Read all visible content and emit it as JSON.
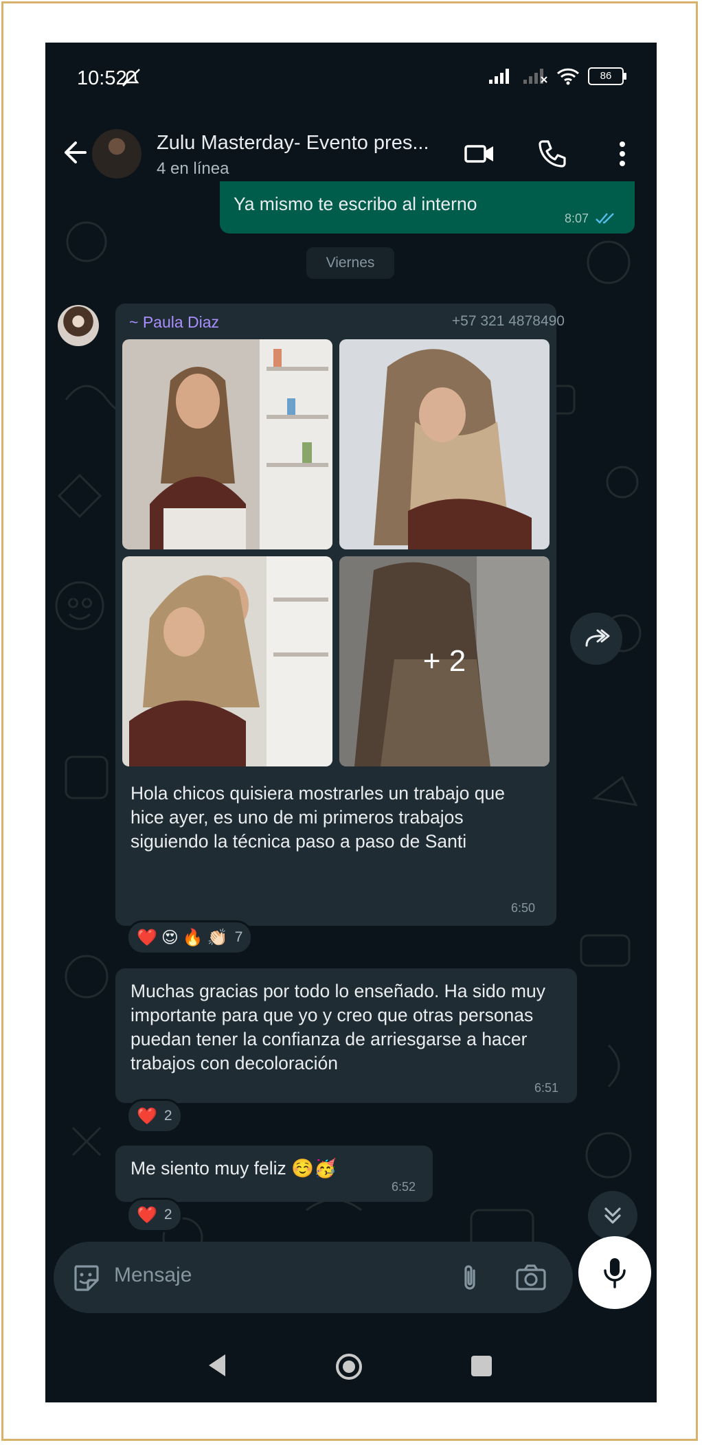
{
  "status_bar": {
    "time": "10:52",
    "battery": "86"
  },
  "header": {
    "title": "Zulu Masterday- Evento pres...",
    "subtitle": "4 en línea"
  },
  "messages": {
    "outgoing": {
      "text": "Ya mismo te escribo al interno",
      "time": "8:07"
    },
    "day_separator": "Viernes",
    "album": {
      "sender": "~ Paula Diaz",
      "phone": "+57 321 4878490",
      "more_count": "+ 2",
      "caption": "Hola chicos quisiera mostrarles un trabajo que hice ayer, es uno de mi primeros trabajos siguiendo la técnica paso a paso de Santi",
      "time": "6:50",
      "reactions": {
        "emojis": [
          "❤️",
          "😍",
          "🔥",
          "👏🏻"
        ],
        "count": "7"
      }
    },
    "msg2": {
      "text": "Muchas gracias por todo lo enseñado. Ha sido muy importante para que yo y creo que otras personas puedan tener la confianza de arriesgarse a hacer trabajos con decoloración",
      "time": "6:51",
      "reactions": {
        "emoji": "❤️",
        "count": "2"
      }
    },
    "msg3": {
      "text": "Me siento muy feliz ☺️🥳",
      "time": "6:52",
      "reactions": {
        "emoji": "❤️",
        "count": "2"
      }
    }
  },
  "composer": {
    "placeholder": "Mensaje"
  },
  "colors": {
    "background": "#0b141a",
    "incoming_bubble": "#202c33",
    "outgoing_bubble": "#005c4b",
    "sender_name": "#a98ffd",
    "read_ticks": "#53bdeb",
    "frame": "#d8b26a"
  }
}
